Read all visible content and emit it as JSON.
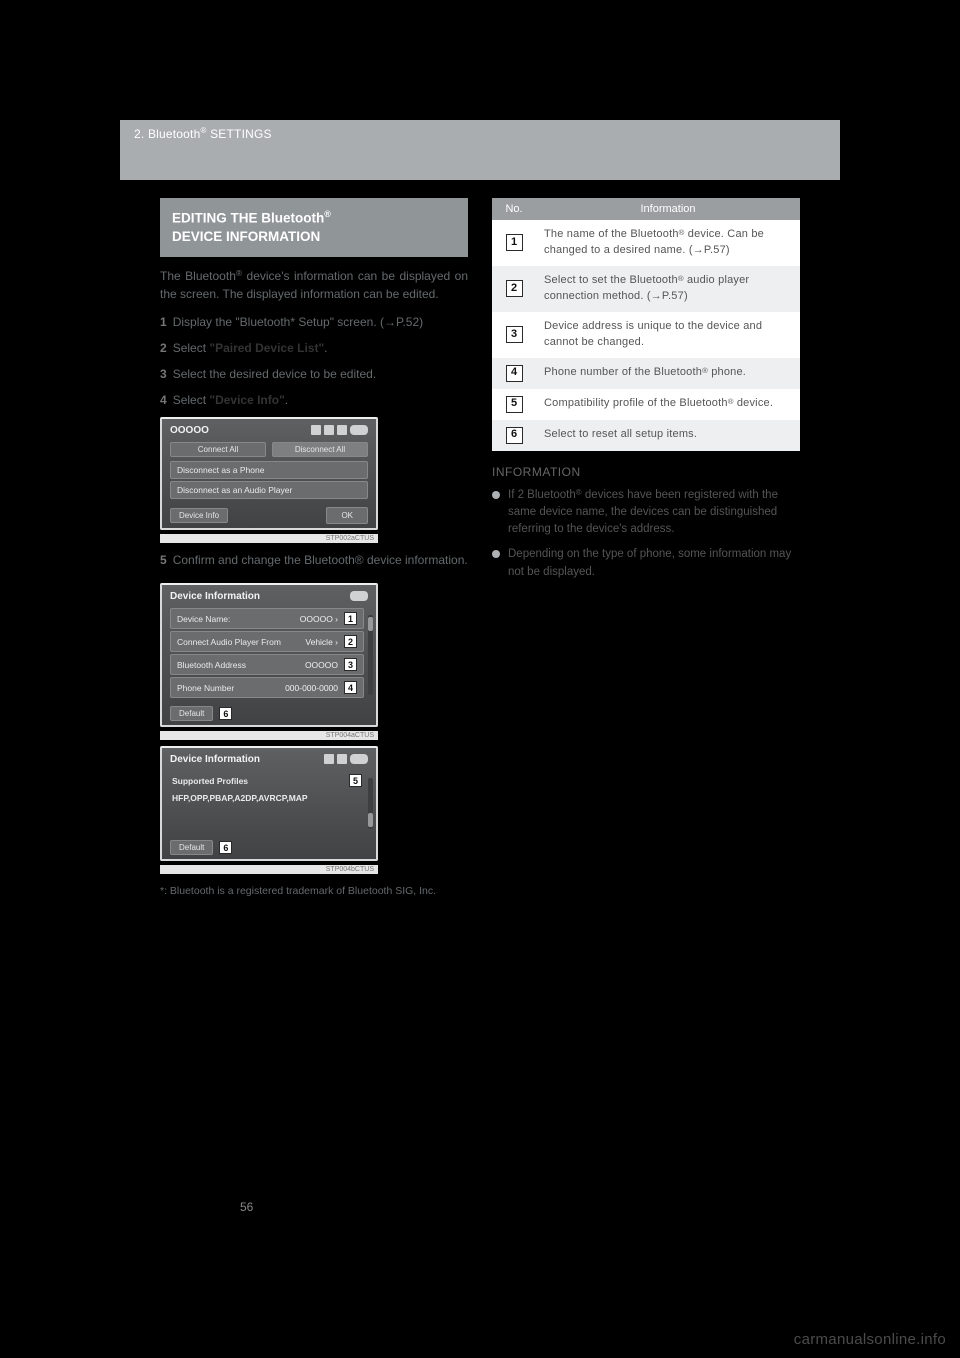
{
  "header": {
    "section_prefix": "2. Bluetooth",
    "section_suffix": " SETTINGS"
  },
  "callout": {
    "line1_prefix": "EDITING THE Bluetooth",
    "line2": "DEVICE INFORMATION"
  },
  "left": {
    "intro_prefix": "The Bluetooth",
    "intro_suffix": " device's information can be displayed on the screen. The displayed information can be edited.",
    "step1_num": "1",
    "step1": "Display the \"Bluetooth* Setup\" screen. (→P.52)",
    "step2_num": "2",
    "step2_a": "Select ",
    "step2_b": "\"Paired Device List\"",
    "step2_c": ".",
    "step3_num": "3",
    "step3": "Select the desired device to be edited.",
    "step4_num": "4",
    "step4_a": "Select ",
    "step4_b": "\"Device Info\"",
    "step4_c": ".",
    "step5_num": "5",
    "step5": "Confirm and change the Bluetooth® device information.",
    "footnote": "*: Bluetooth is a registered trademark of Bluetooth SIG, Inc."
  },
  "screenshot1": {
    "title": "OOOOO",
    "connect_all": "Connect All",
    "disconnect_all": "Disconnect All",
    "row_phone": "Disconnect as a Phone",
    "row_audio": "Disconnect as an Audio Player",
    "device_info": "Device Info",
    "ok": "OK",
    "caption": "STP002aCTUS"
  },
  "screenshot2": {
    "title": "Device Information",
    "rows": [
      {
        "label": "Device Name:",
        "value": "OOOOO ›",
        "num": "1"
      },
      {
        "label": "Connect Audio Player From",
        "value": "Vehicle ›",
        "num": "2"
      },
      {
        "label": "Bluetooth Address",
        "value": "OOOOO",
        "num": "3"
      },
      {
        "label": "Phone Number",
        "value": "000-000-0000",
        "num": "4"
      }
    ],
    "default": "Default",
    "default_num": "6",
    "caption": "STP004aCTUS"
  },
  "screenshot3": {
    "title": "Device Information",
    "supported": "Supported Profiles",
    "supported_num": "5",
    "profiles": "HFP,OPP,PBAP,A2DP,AVRCP,MAP",
    "default": "Default",
    "default_num": "6",
    "caption": "STP004bCTUS"
  },
  "table": {
    "headers": {
      "no": "No.",
      "info": "Information"
    },
    "rows": [
      {
        "num": "1",
        "text_a": "The name of the Bluetooth",
        "text_b": " device. Can be changed to a desired name. (→P.57)"
      },
      {
        "num": "2",
        "text_a": "Select to set the Bluetooth",
        "text_b": " audio player connection method. (→P.57)"
      },
      {
        "num": "3",
        "text_a": "Device address is unique to the device and cannot be changed.",
        "text_b": ""
      },
      {
        "num": "4",
        "text_a": "Phone number of the Bluetooth",
        "text_b": " phone."
      },
      {
        "num": "5",
        "text_a": "Compatibility profile of the Bluetooth",
        "text_b": " device."
      },
      {
        "num": "6",
        "text_a": "Select to reset all setup items.",
        "text_b": ""
      }
    ]
  },
  "right": {
    "info_head": "INFORMATION",
    "bullet1_a": "If 2 Bluetooth",
    "bullet1_b": " devices have been registered with the same device name, the devices can be distinguished referring to the device's address.",
    "bullet2_a": "Depending on the type of phone, some information may not be displayed."
  },
  "page_number": "56",
  "watermark": "carmanualsonline.info"
}
